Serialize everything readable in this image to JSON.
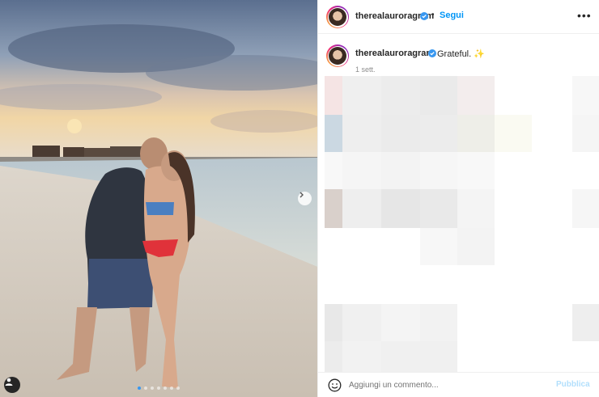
{
  "post": {
    "username": "therealauroragram",
    "follow_label": "Segui",
    "bullet": "•",
    "more_label": "•••",
    "caption": "Grateful. ✨",
    "time_ago": "1 sett."
  },
  "comment": {
    "placeholder": "Aggiungi un commento...",
    "publish_label": "Pubblica"
  },
  "icons": {
    "verified": "verified-badge-icon",
    "next": "chevron-right-icon",
    "user_tag": "user-tag-icon",
    "emoji": "smiley-icon",
    "more": "more-options-icon"
  },
  "carousel": {
    "slides": 7,
    "active_index": 0
  },
  "colors": {
    "accent": "#0095f6",
    "verified": "#3897f0",
    "publish_disabled": "#b2dffc"
  }
}
